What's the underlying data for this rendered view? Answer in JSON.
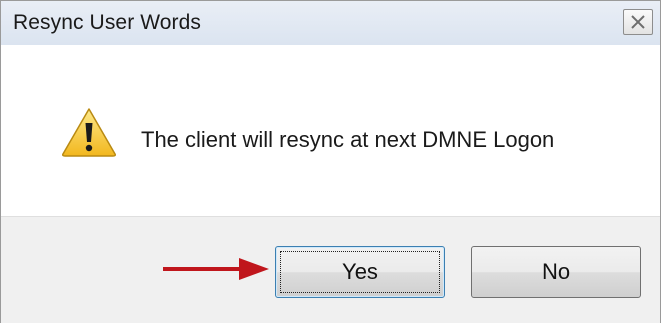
{
  "window": {
    "title": "Resync User Words"
  },
  "icons": {
    "close": "close-icon",
    "warning": "warning-icon",
    "annotation": "red-arrow-icon"
  },
  "dialog": {
    "message": "The client will resync at next DMNE Logon"
  },
  "buttons": {
    "yes_label": "Yes",
    "no_label": "No",
    "default": "Yes"
  },
  "colors": {
    "arrow": "#c0161c",
    "warning_fill": "#f4c430"
  }
}
